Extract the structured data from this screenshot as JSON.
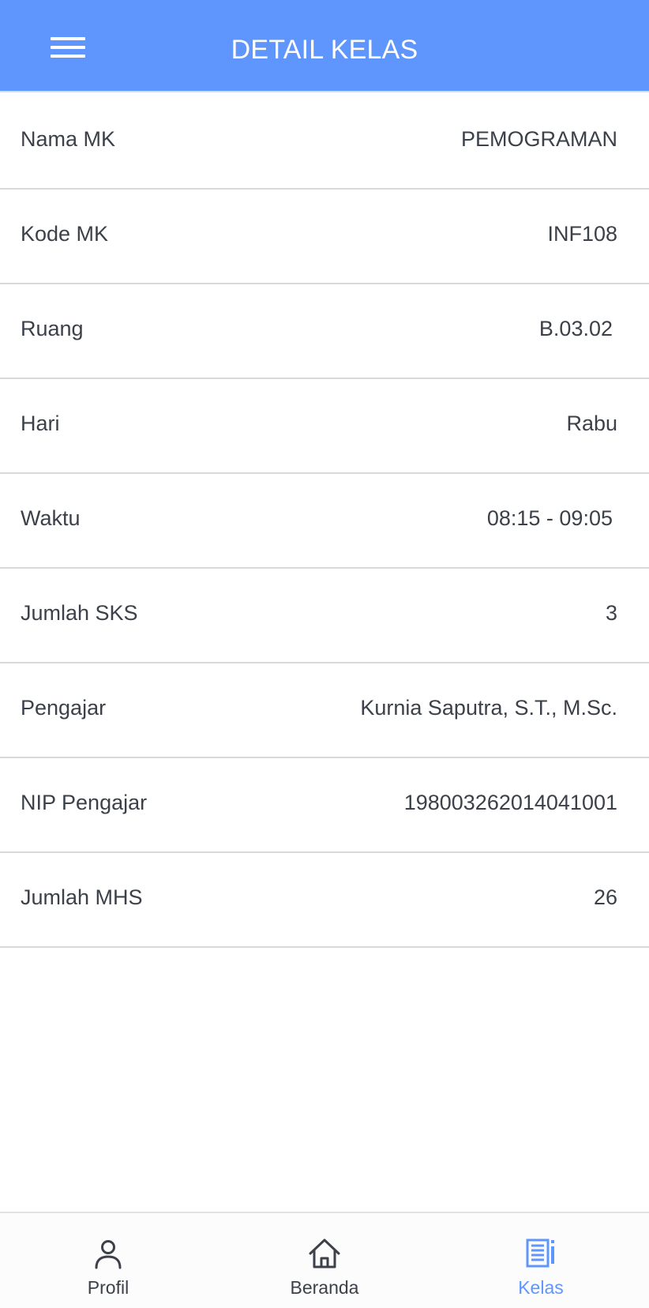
{
  "header": {
    "title": "DETAIL KELAS",
    "menu_icon": "hamburger-menu-icon",
    "background_color": "#5f96fe"
  },
  "details": [
    {
      "label": "Nama MK",
      "value": "PEMOGRAMAN"
    },
    {
      "label": "Kode MK",
      "value": "INF108"
    },
    {
      "label": "Ruang",
      "value": "B.03.02"
    },
    {
      "label": "Hari",
      "value": "Rabu"
    },
    {
      "label": "Waktu",
      "value": "08:15 - 09:05"
    },
    {
      "label": "Jumlah SKS",
      "value": "3"
    },
    {
      "label": "Pengajar",
      "value": "Kurnia Saputra, S.T., M.Sc."
    },
    {
      "label": "NIP Pengajar",
      "value": "198003262014041001"
    },
    {
      "label": "Jumlah MHS",
      "value": "26"
    }
  ],
  "bottom_nav": {
    "items": [
      {
        "label": "Profil",
        "icon": "person-icon",
        "active": false
      },
      {
        "label": "Beranda",
        "icon": "home-icon",
        "active": false
      },
      {
        "label": "Kelas",
        "icon": "document-list-icon",
        "active": true
      }
    ],
    "active_color": "#5f96fe",
    "inactive_color": "#3c4149"
  }
}
